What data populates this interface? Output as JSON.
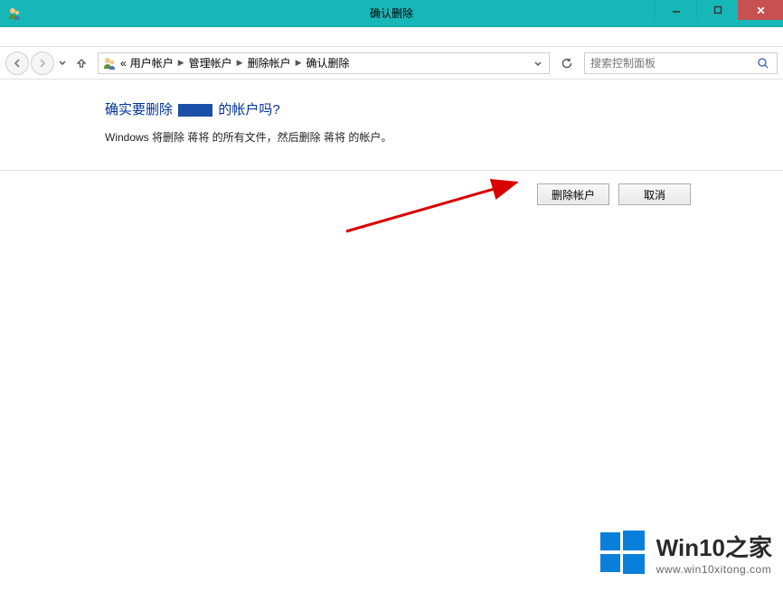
{
  "window": {
    "title": "确认删除"
  },
  "breadcrumb": {
    "items": [
      "用户帐户",
      "管理帐户",
      "删除帐户",
      "确认删除"
    ]
  },
  "search": {
    "placeholder": "搜索控制面板"
  },
  "main": {
    "heading_prefix": "确实要删除",
    "heading_suffix": "的帐户吗?",
    "description": "Windows 将删除 蒋将 的所有文件，然后删除 蒋将 的帐户。"
  },
  "buttons": {
    "delete": "删除帐户",
    "cancel": "取消"
  },
  "watermark": {
    "title": "Win10之家",
    "url": "www.win10xitong.com"
  }
}
